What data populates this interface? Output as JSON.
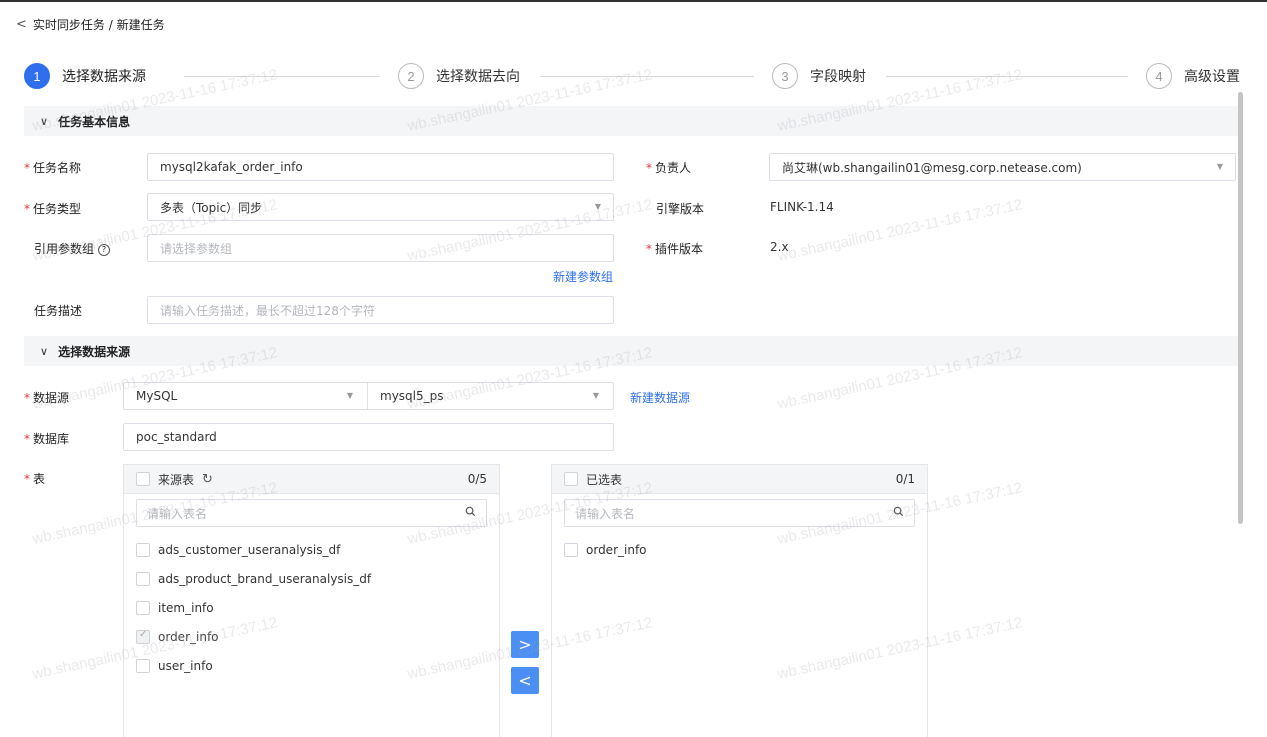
{
  "breadcrumb": {
    "back_icon": "chevron-left-icon",
    "text": "实时同步任务 / 新建任务"
  },
  "steps": [
    {
      "num": "1",
      "label": "选择数据来源",
      "active": true
    },
    {
      "num": "2",
      "label": "选择数据去向",
      "active": false
    },
    {
      "num": "3",
      "label": "字段映射",
      "active": false
    },
    {
      "num": "4",
      "label": "高级设置",
      "active": false
    }
  ],
  "section_basic": {
    "title": "任务基本信息",
    "chevron": "∨"
  },
  "form": {
    "task_name_label": "任务名称",
    "task_name_value": "mysql2kafak_order_info",
    "owner_label": "负责人",
    "owner_value": "尚艾琳(wb.shangailin01@mesg.corp.netease.com)",
    "task_type_label": "任务类型",
    "task_type_value": "多表（Topic）同步",
    "engine_label": "引擎版本",
    "engine_value": "FLINK-1.14",
    "param_group_label": "引用参数组",
    "param_group_placeholder": "请选择参数组",
    "plugin_label": "插件版本",
    "plugin_value": "2.x",
    "new_param_group": "新建参数组",
    "desc_label": "任务描述",
    "desc_placeholder": "请输入任务描述，最长不超过128个字符"
  },
  "section_source": {
    "title": "选择数据来源",
    "chevron": "∨"
  },
  "source": {
    "datasource_label": "数据源",
    "datasource_type": "MySQL",
    "datasource_name": "mysql5_ps",
    "new_datasource": "新建数据源",
    "database_label": "数据库",
    "database_value": "poc_standard",
    "table_label": "表"
  },
  "transfer": {
    "left_title": "来源表",
    "left_count": "0/5",
    "left_search_placeholder": "请输入表名",
    "left_items": [
      {
        "name": "ads_customer_useranalysis_df",
        "checked": false
      },
      {
        "name": "ads_product_brand_useranalysis_df",
        "checked": false
      },
      {
        "name": "item_info",
        "checked": false
      },
      {
        "name": "order_info",
        "checked": true
      },
      {
        "name": "user_info",
        "checked": false
      }
    ],
    "right_title": "已选表",
    "right_count": "0/1",
    "right_search_placeholder": "请输入表名",
    "right_items": [
      {
        "name": "order_info",
        "checked": false
      }
    ],
    "move_right": ">",
    "move_left": "<"
  },
  "watermark": "wb.shangailin01 2023-11-16 17:37:12",
  "colors": {
    "primary": "#2f6fed",
    "required": "#e0393e",
    "header_bg": "#f4f5f7",
    "transfer_btn": "#4b8ff5"
  }
}
